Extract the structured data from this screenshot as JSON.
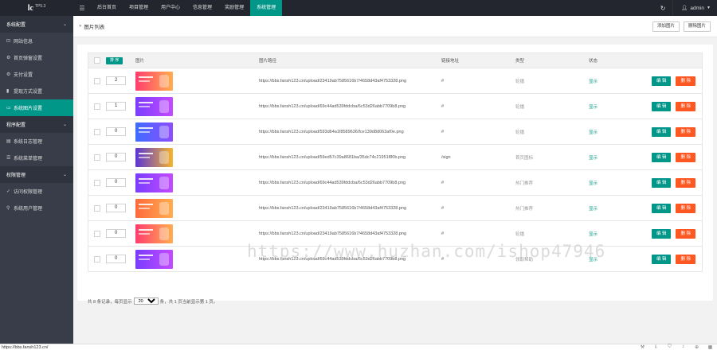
{
  "logo": {
    "main": "lc",
    "version": "TP5.3"
  },
  "topnav": {
    "items": [
      "后台首页",
      "项目管理",
      "用户中心",
      "信息管理",
      "奖励管理",
      "系统管理"
    ],
    "active_index": 5,
    "user": "admin"
  },
  "sidebar": [
    {
      "type": "group",
      "label": "系统配置"
    },
    {
      "type": "item",
      "label": "网站信息",
      "icon": "info-icon"
    },
    {
      "type": "item",
      "label": "首页弹窗设置",
      "icon": "gear-icon"
    },
    {
      "type": "item",
      "label": "支付设置",
      "icon": "gear-icon"
    },
    {
      "type": "item",
      "label": "提现方式设置",
      "icon": "bookmark-icon"
    },
    {
      "type": "item",
      "label": "系统图片设置",
      "icon": "image-icon",
      "active": true
    },
    {
      "type": "group",
      "label": "程序配置"
    },
    {
      "type": "item",
      "label": "系统日志管理",
      "icon": "file-icon"
    },
    {
      "type": "item",
      "label": "系统菜单管理",
      "icon": "list-icon"
    },
    {
      "type": "group",
      "label": "权限管理"
    },
    {
      "type": "item",
      "label": "访问权限管理",
      "icon": "check-icon"
    },
    {
      "type": "item",
      "label": "系统用户管理",
      "icon": "user-icon"
    }
  ],
  "breadcrumb": {
    "title": "图片列表"
  },
  "actions": {
    "add": "添加图片",
    "delete": "删除图片"
  },
  "table": {
    "headers": {
      "sort": "排 序",
      "image": "图片",
      "path": "图片路径",
      "link": "链接地址",
      "type": "类型",
      "status": "状态"
    },
    "rows": [
      {
        "sort": "2",
        "path": "https://bbs.fansh123.cn/upload/23419ab7585616b7/4658d43af4753328.png",
        "link": "#",
        "type": "轮播",
        "status": "显示",
        "thumb": [
          "#ff3d6e",
          "#ffae4f"
        ]
      },
      {
        "sort": "1",
        "path": "https://bbs.fansh123.cn/upload/69c44ad539fddcba/6c53d26abb7709b8.png",
        "link": "#",
        "type": "轮播",
        "status": "显示",
        "thumb": [
          "#7a3cff",
          "#c34bff"
        ]
      },
      {
        "sort": "0",
        "path": "https://bbs.fansh123.cn/upload/593d64a1f8589636/fce139d8d063af0e.png",
        "link": "#",
        "type": "轮播",
        "status": "显示",
        "thumb": [
          "#3d6cff",
          "#8e4dff"
        ]
      },
      {
        "sort": "0",
        "path": "https://bbs.fansh123.cn/upload/59ed57c39a8681ba/35dc74c21951f80b.png",
        "link": "/sign",
        "type": "首页图标",
        "status": "显示",
        "thumb": [
          "#5b35d6",
          "#f5b52c"
        ]
      },
      {
        "sort": "0",
        "path": "https://bbs.fansh123.cn/upload/69c44ad539fddcba/6c53d26abb7709b8.png",
        "link": "#",
        "type": "热门推荐",
        "status": "显示",
        "thumb": [
          "#7a3cff",
          "#c34bff"
        ]
      },
      {
        "sort": "0",
        "path": "https://bbs.fansh123.cn/upload/23419ab7585616b7/4658d43af4753328.png",
        "link": "#",
        "type": "热门推荐",
        "status": "显示",
        "thumb": [
          "#ff6a3d",
          "#ffae4f"
        ]
      },
      {
        "sort": "0",
        "path": "https://bbs.fansh123.cn/upload/23419ab7585616b7/4658d43af4753328.png",
        "link": "#",
        "type": "轮播",
        "status": "显示",
        "thumb": [
          "#ff3d6e",
          "#ffae4f"
        ]
      },
      {
        "sort": "0",
        "path": "https://bbs.fansh123.cn/upload/69c44ad539fddcba/6c53d26abb7709b8.png",
        "link": "#",
        "type": "领取帮助",
        "status": "显示",
        "thumb": [
          "#7a3cff",
          "#c34bff"
        ]
      }
    ],
    "edit_label": "编 辑",
    "delete_label": "删 除"
  },
  "pager": {
    "prefix": "共 8 条记录，每页显示",
    "per_page": "20",
    "suffix": "条，共 1 页当前显示第 1 页。"
  },
  "watermark": "https://www.huzhan.com/ishop47946",
  "statusbar": {
    "url": "https://bbs.fansh123.cn/"
  },
  "colors": {
    "accent": "#009688",
    "danger": "#ff5722",
    "topbar": "#23262e",
    "sidebar": "#393d49"
  }
}
